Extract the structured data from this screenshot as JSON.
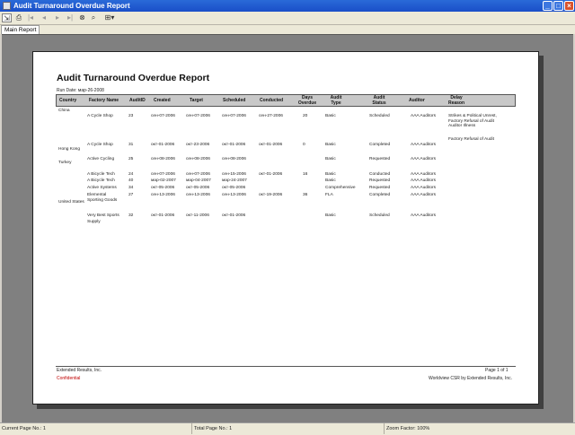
{
  "window": {
    "title": "Audit Turnaround Overdue Report"
  },
  "tabs": [
    "Main Report"
  ],
  "report": {
    "title": "Audit Turnaround Overdue Report",
    "run_date": "Run Date: мар-26-2008",
    "headers": [
      "Country",
      "Factory Name",
      "AuditID",
      "Created",
      "Target",
      "Scheduled",
      "Conducted",
      "Days Overdue",
      "Audit Type",
      "Audit Status",
      "Auditor",
      "Delay Reason"
    ],
    "countries": [
      "China",
      "Hong Kong",
      "Turkey",
      "United States"
    ],
    "rows": [
      {
        "factory": "A Cycle Shop",
        "id": "23",
        "created": "сен-07-2006",
        "target": "сен-07-2006",
        "scheduled": "сен-07-2006",
        "conducted": "сен-27-2006",
        "overdue": "20",
        "type": "Basic",
        "status": "Scheduled",
        "auditor": "AAA Auditors",
        "reason": "Strikes & Political Unrest, Factory Refusal of Audit Auditor Illness"
      },
      {
        "factory": "",
        "id": "",
        "created": "",
        "target": "",
        "scheduled": "",
        "conducted": "",
        "overdue": "",
        "type": "",
        "status": "",
        "auditor": "",
        "reason": "Factory Refusal of Audit"
      },
      {
        "factory": "A Cycle Shop",
        "id": "31",
        "created": "окт-01-2006",
        "target": "окт-23-2006",
        "scheduled": "окт-01-2006",
        "conducted": "окт-01-2006",
        "overdue": "0",
        "type": "Basic",
        "status": "Completed",
        "auditor": "AAA Auditors",
        "reason": ""
      },
      {
        "factory": "Active Cycling",
        "id": "25",
        "created": "сен-08-2006",
        "target": "сен-08-2006",
        "scheduled": "сен-08-2006",
        "conducted": "",
        "overdue": "",
        "type": "Basic",
        "status": "Requested",
        "auditor": "AAA Auditors",
        "reason": ""
      },
      {
        "factory": "A Bicycle Tech",
        "id": "24",
        "created": "сен-07-2006",
        "target": "сен-07-2006",
        "scheduled": "сен-15-2006",
        "conducted": "окт-01-2006",
        "overdue": "16",
        "type": "Basic",
        "status": "Conducted",
        "auditor": "AAA Auditors",
        "reason": ""
      },
      {
        "factory": "A Bicycle Tech",
        "id": "40",
        "created": "мар-02-2007",
        "target": "мар-04-2007",
        "scheduled": "мар-24-2007",
        "conducted": "",
        "overdue": "",
        "type": "Basic",
        "status": "Requested",
        "auditor": "AAA Auditors",
        "reason": ""
      },
      {
        "factory": "Active Systems",
        "id": "34",
        "created": "окт-05-2006",
        "target": "окт-05-2006",
        "scheduled": "окт-05-2006",
        "conducted": "",
        "overdue": "",
        "type": "Comprehensive",
        "status": "Requested",
        "auditor": "AAA Auditors",
        "reason": ""
      },
      {
        "factory": "Elemental",
        "id": "27",
        "created": "сен-13-2006",
        "target": "сен-13-2006",
        "scheduled": "сен-13-2006",
        "conducted": "окт-19-2006",
        "overdue": "36",
        "type": "FLA",
        "status": "Completed",
        "auditor": "AAA Auditors",
        "reason": ""
      },
      {
        "factory": "Sporting Goods",
        "id": "",
        "created": "",
        "target": "",
        "scheduled": "",
        "conducted": "",
        "overdue": "",
        "type": "",
        "status": "",
        "auditor": "",
        "reason": ""
      },
      {
        "factory": "Very Best Sports",
        "id": "32",
        "created": "окт-01-2006",
        "target": "окт-11-2006",
        "scheduled": "окт-01-2006",
        "conducted": "",
        "overdue": "",
        "type": "Basic",
        "status": "Scheduled",
        "auditor": "AAA Auditors",
        "reason": ""
      },
      {
        "factory": "Supply",
        "id": "",
        "created": "",
        "target": "",
        "scheduled": "",
        "conducted": "",
        "overdue": "",
        "type": "",
        "status": "",
        "auditor": "",
        "reason": ""
      }
    ],
    "footer": {
      "company": "Extended Results, Inc.",
      "confidential": "Confidential",
      "page": "Page 1 of 1",
      "credit": "Worldview CSR by Extended Results, Inc."
    }
  },
  "status": {
    "current_page": "Current Page No.: 1",
    "total_page": "Total Page No.: 1",
    "zoom": "Zoom Factor: 100%"
  }
}
